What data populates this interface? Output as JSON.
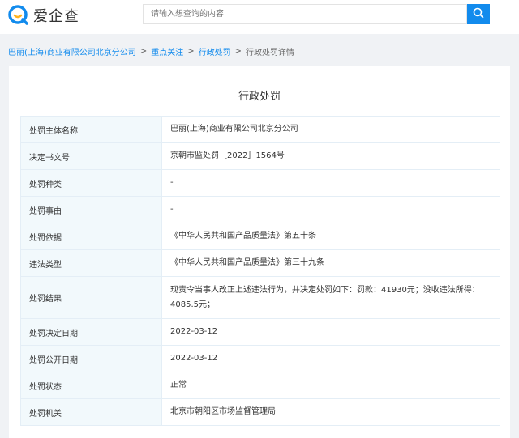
{
  "brand": {
    "logo_text": "爱企查",
    "accent": "#128bed"
  },
  "search": {
    "placeholder": "请输入想查询的内容",
    "icon": "search-icon"
  },
  "breadcrumb": [
    {
      "label": "巴丽(上海)商业有限公司北京分公司",
      "link": true
    },
    {
      "label": "重点关注",
      "link": true
    },
    {
      "label": "行政处罚",
      "link": true
    },
    {
      "label": "行政处罚详情",
      "link": false
    }
  ],
  "page": {
    "title": "行政处罚"
  },
  "details": [
    {
      "key": "处罚主体名称",
      "value": "巴丽(上海)商业有限公司北京分公司"
    },
    {
      "key": "决定书文号",
      "value": "京朝市监处罚［2022］1564号"
    },
    {
      "key": "处罚种类",
      "value": "-"
    },
    {
      "key": "处罚事由",
      "value": "-"
    },
    {
      "key": "处罚依据",
      "value": "《中华人民共和国产品质量法》第五十条"
    },
    {
      "key": "违法类型",
      "value": "《中华人民共和国产品质量法》第三十九条"
    },
    {
      "key": "处罚结果",
      "value": "现责令当事人改正上述违法行为，并决定处罚如下：罚款：41930元；没收违法所得：4085.5元；"
    },
    {
      "key": "处罚决定日期",
      "value": "2022-03-12"
    },
    {
      "key": "处罚公开日期",
      "value": "2022-03-12"
    },
    {
      "key": "处罚状态",
      "value": "正常"
    },
    {
      "key": "处罚机关",
      "value": "北京市朝阳区市场监督管理局"
    }
  ]
}
